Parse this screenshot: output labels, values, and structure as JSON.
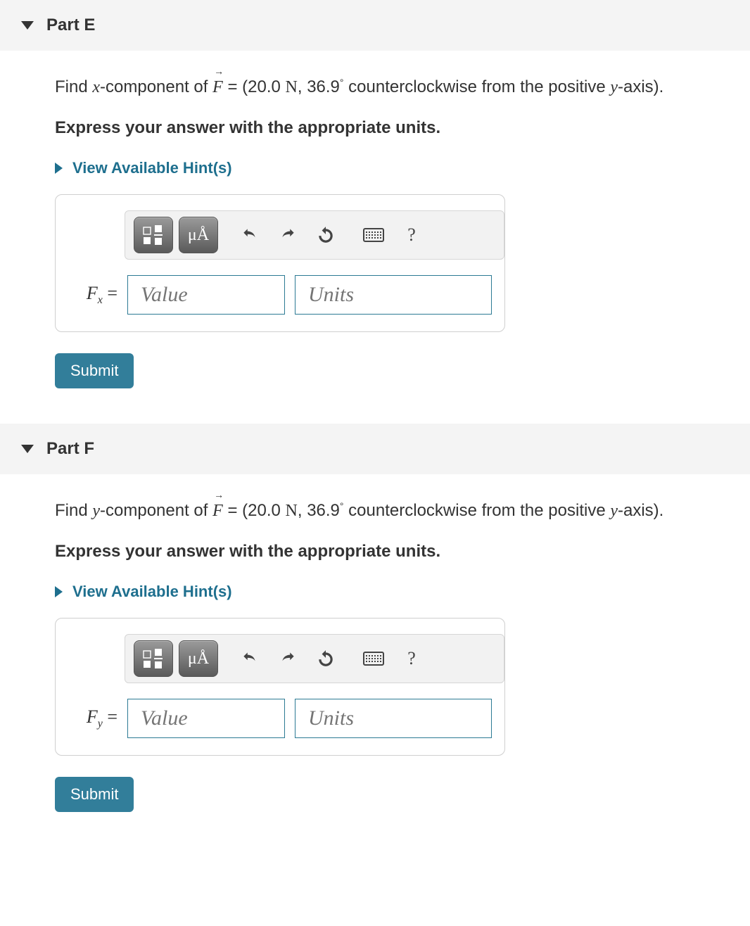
{
  "partE": {
    "title": "Part E",
    "prompt_prefix": "Find ",
    "component_var": "x",
    "prompt_mid1": "-component of ",
    "vector": "F",
    "prompt_mid2": " = (20.0 ",
    "unit_sym": "N",
    "prompt_mid3": ", 36.9",
    "deg": "°",
    "prompt_suffix": " counterclockwise from the positive ",
    "axis_var": "y",
    "prompt_end": "-axis).",
    "instruction": "Express your answer with the appropriate units.",
    "hints_label": "View Available Hint(s)",
    "var_label_main": "F",
    "var_label_sub": "x",
    "equals": " =",
    "value_ph": "Value",
    "units_ph": "Units",
    "submit": "Submit",
    "toolbar": {
      "mu_angstrom": "μÅ",
      "question": "?"
    }
  },
  "partF": {
    "title": "Part F",
    "prompt_prefix": "Find ",
    "component_var": "y",
    "prompt_mid1": "-component of ",
    "vector": "F",
    "prompt_mid2": " = (20.0 ",
    "unit_sym": "N",
    "prompt_mid3": ", 36.9",
    "deg": "°",
    "prompt_suffix": " counterclockwise from the positive ",
    "axis_var": "y",
    "prompt_end": "-axis).",
    "instruction": "Express your answer with the appropriate units.",
    "hints_label": "View Available Hint(s)",
    "var_label_main": "F",
    "var_label_sub": "y",
    "equals": " =",
    "value_ph": "Value",
    "units_ph": "Units",
    "submit": "Submit",
    "toolbar": {
      "mu_angstrom": "μÅ",
      "question": "?"
    }
  }
}
